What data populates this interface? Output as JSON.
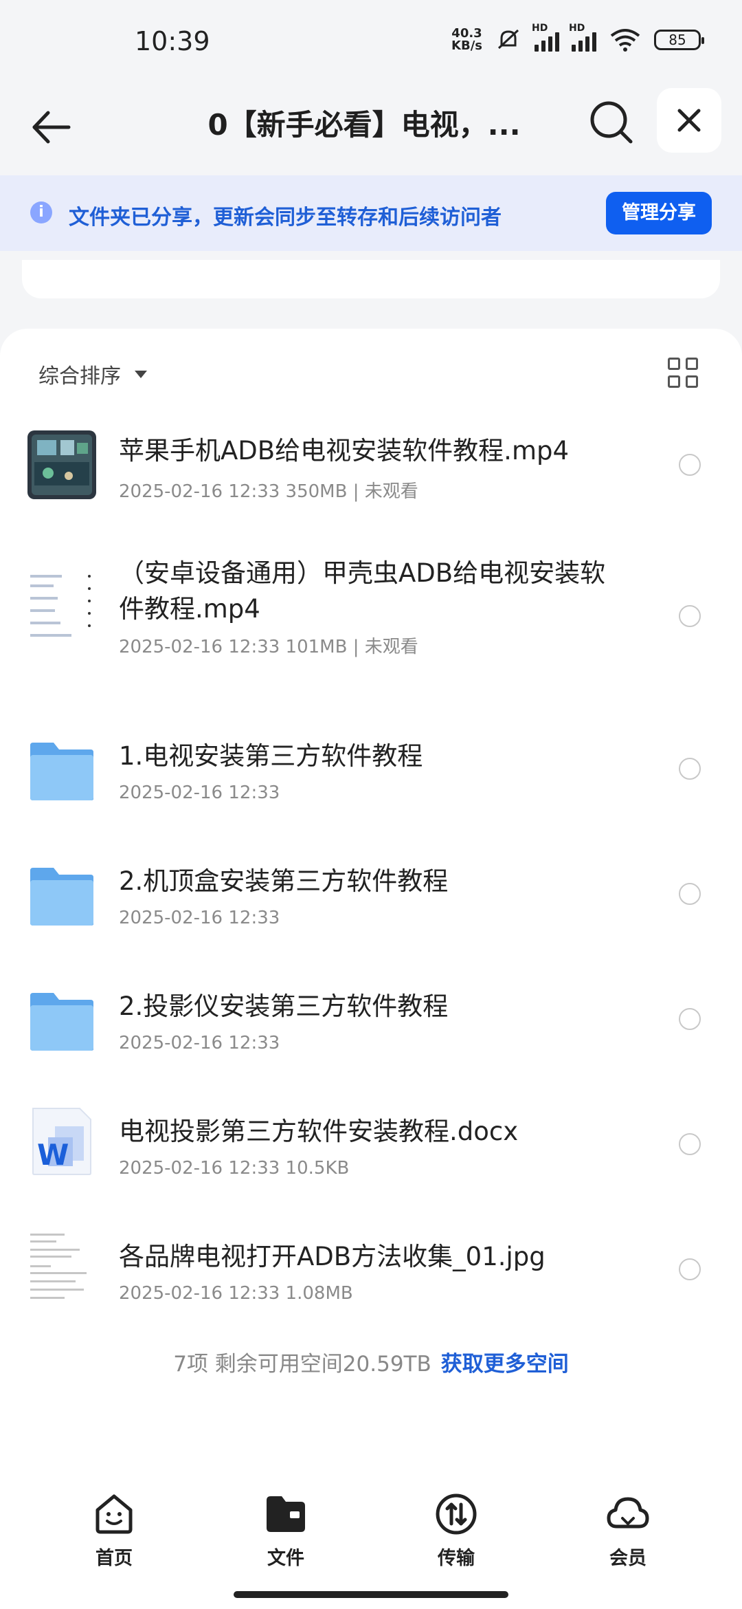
{
  "status": {
    "time": "10:39",
    "net_speed_top": "40.3",
    "net_speed_unit": "KB/s",
    "sig1_label": "HD",
    "sig2_label": "HD",
    "battery": "85"
  },
  "header": {
    "title": "0【新手必看】电视，..."
  },
  "banner": {
    "text": "文件夹已分享，更新会同步至转存和后续访问者",
    "button": "管理分享"
  },
  "sort": {
    "label": "综合排序"
  },
  "files": [
    {
      "name": "苹果手机ADB给电视安装软件教程.mp4",
      "meta": "2025-02-16 12:33  350MB | 未观看",
      "type": "video"
    },
    {
      "name": "（安卓设备通用）甲壳虫ADB给电视安装软件教程.mp4",
      "meta": "2025-02-16 12:33  101MB | 未观看",
      "type": "doc-thumb"
    },
    {
      "name": "1.电视安装第三方软件教程",
      "meta": "2025-02-16 12:33",
      "type": "folder"
    },
    {
      "name": "2.机顶盒安装第三方软件教程",
      "meta": "2025-02-16 12:33",
      "type": "folder"
    },
    {
      "name": "2.投影仪安装第三方软件教程",
      "meta": "2025-02-16 12:33",
      "type": "folder"
    },
    {
      "name": "电视投影第三方软件安装教程.docx",
      "meta": "2025-02-16 12:33  10.5KB",
      "type": "word"
    },
    {
      "name": "各品牌电视打开ADB方法收集_01.jpg",
      "meta": "2025-02-16 12:33  1.08MB",
      "type": "image"
    }
  ],
  "footer": {
    "summary": "7项 剩余可用空间20.59TB",
    "link": "获取更多空间"
  },
  "nav": {
    "home": "首页",
    "files": "文件",
    "transfer": "传输",
    "member": "会员"
  },
  "colors": {
    "accent": "#0f5ff0",
    "banner_bg": "#e8ecfb",
    "folder": "#7dbdf5"
  }
}
